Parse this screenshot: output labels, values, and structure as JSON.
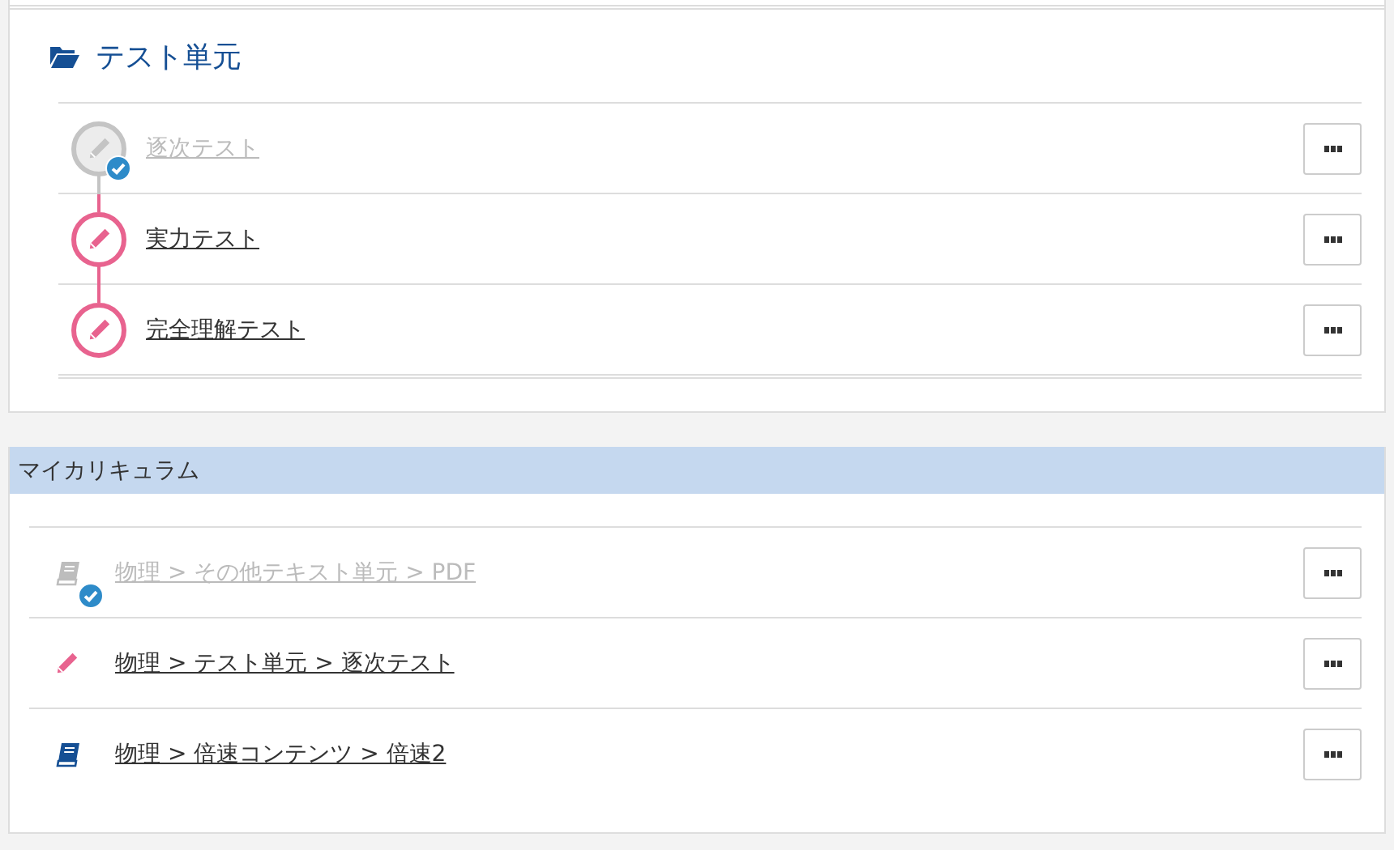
{
  "unit": {
    "title": "テスト単元",
    "items": [
      {
        "kind": "test",
        "title": "逐次テスト",
        "completed": true
      },
      {
        "kind": "test",
        "title": "実力テスト",
        "completed": false
      },
      {
        "kind": "test",
        "title": "完全理解テスト",
        "completed": false
      }
    ]
  },
  "curriculum": {
    "title": "マイカリキュラム",
    "items": [
      {
        "kind": "text",
        "path": "物理 > その他テキスト単元 > PDF",
        "completed": true
      },
      {
        "kind": "test",
        "path": "物理 > テスト単元 > 逐次テスト",
        "completed": false
      },
      {
        "kind": "text",
        "path": "物理 > 倍速コンテンツ > 倍速2",
        "completed": false
      }
    ]
  }
}
